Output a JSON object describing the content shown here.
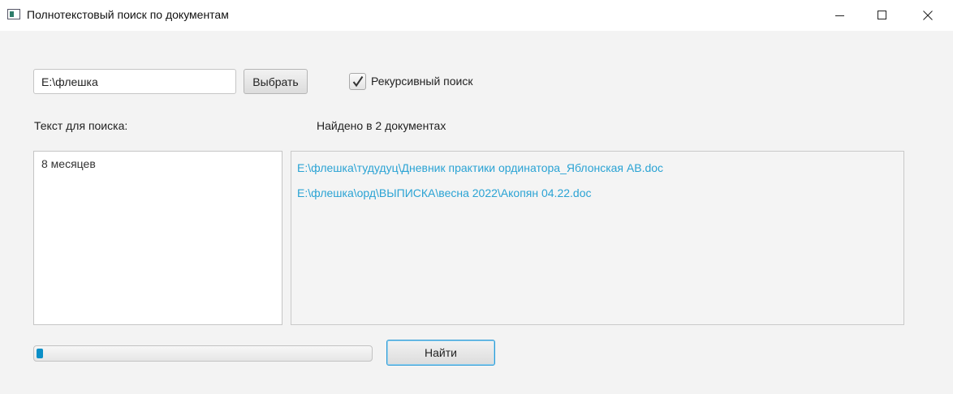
{
  "window": {
    "title": "Полнотекстовый поиск по документам",
    "icon": "app-window-icon",
    "controls": [
      "minimize-icon",
      "maximize-icon",
      "close-icon"
    ]
  },
  "path": {
    "value": "E:\\флешка",
    "choose_label": "Выбрать"
  },
  "recursive": {
    "label": "Рекурсивный поиск",
    "checked": true
  },
  "search": {
    "label": "Текст для поиска:",
    "query": "8 месяцев",
    "button_label": "Найти"
  },
  "results": {
    "summary": "Найдено в 2 документах",
    "items": [
      "E:\\флешка\\тудудуц\\Дневник практики ординатора_Яблонская АВ.doc",
      "E:\\флешка\\орд\\ВЫПИСКА\\весна 2022\\Акопян 04.22.doc"
    ]
  },
  "progress": {
    "value": 0.02
  },
  "colors": {
    "link": "#2aa3d4",
    "accent": "#0a8fc7"
  }
}
